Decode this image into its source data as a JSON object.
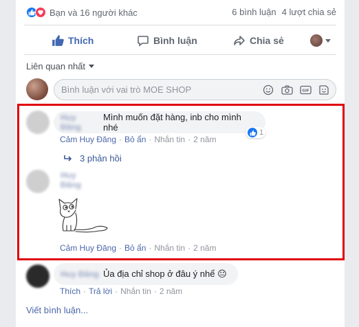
{
  "reactions": {
    "summary": "Bạn và 16 người khác",
    "icons": [
      "like-icon",
      "love-icon"
    ]
  },
  "counts": {
    "comments": "6 bình luận",
    "shares": "4 lượt chia sẻ"
  },
  "actions": {
    "like": "Thích",
    "comment": "Bình luận",
    "share": "Chia sẻ"
  },
  "sort": {
    "label": "Liên quan nhất"
  },
  "composer": {
    "placeholder": "Bình luận với vai trò MOE SHOP"
  },
  "comments": [
    {
      "author": "Huy Đăng",
      "text": "Mình muốn đặt hàng, inb cho mình nhé",
      "like_count": "1",
      "meta": {
        "like": "Cảm Huy Đăng",
        "hide": "Bỏ ẩn",
        "message": "Nhắn tin",
        "time": "2 năm"
      },
      "replies": "3 phản hồi"
    },
    {
      "author": "Huy Đăng",
      "sticker": "cat-sticker",
      "meta": {
        "like": "Cảm Huy Đăng",
        "hide": "Bỏ ẩn",
        "message": "Nhắn tin",
        "time": "2 năm"
      }
    },
    {
      "author": "Huy Đăng",
      "text": "Ủa địa chỉ shop ở đâu ý nhể 😐",
      "meta": {
        "like": "Thích",
        "reply": "Trả lời",
        "message": "Nhắn tin",
        "time": "2 năm"
      }
    }
  ],
  "footer": {
    "write_comment": "Viết bình luận..."
  },
  "colors": {
    "accent": "#4267b2",
    "highlight": "#e0000a",
    "link": "#385898"
  }
}
